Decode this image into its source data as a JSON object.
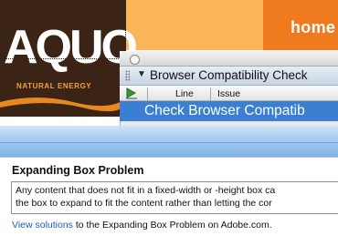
{
  "banner": {
    "home_label": "home"
  },
  "logo": {
    "word": "AQUO",
    "tagline": "NATURAL ENERGY"
  },
  "panel": {
    "header_title": "Browser Compatibility Check",
    "columns": [
      "Line",
      "Issue"
    ],
    "selected_row": "Check Browser Compatib"
  },
  "content": {
    "title": "Expanding Box Problem",
    "description_lines": [
      "Any content that does not fit in a fixed-width or -height box ca",
      "the box to expand to fit the content rather than letting the cor"
    ],
    "link_text": "View solutions",
    "link_suffix": " to the Expanding Box Problem on Adobe.com."
  },
  "colors": {
    "orange": "#f79a2e",
    "home_tab": "#f07a1e",
    "logo_bg": "#3b2415",
    "selection_blue": "#3a7fd2",
    "link_blue": "#1c5fb8"
  }
}
